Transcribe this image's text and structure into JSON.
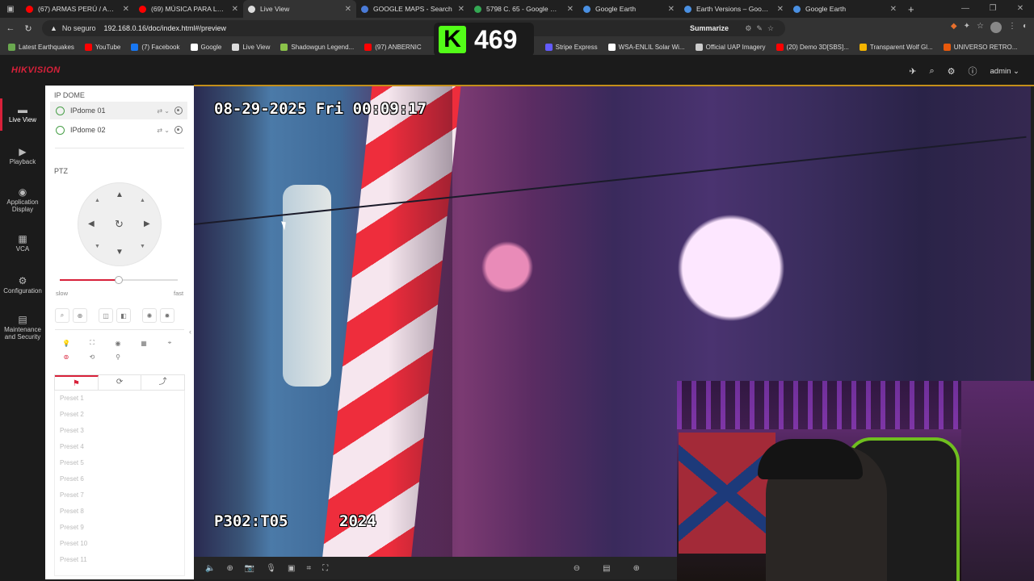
{
  "browser": {
    "tabs": [
      {
        "title": "(67) ARMAS PERÚ / ARMAS",
        "favicon_color": "#ff0000"
      },
      {
        "title": "(69) MÚSICA PARA LEER",
        "favicon_color": "#ff0000"
      },
      {
        "title": "Live View",
        "favicon_color": "#dddddd",
        "active": true
      },
      {
        "title": "GOOGLE MAPS - Search",
        "favicon_color": "#4a7bd8"
      },
      {
        "title": "5798 C. 65 - Google Maps",
        "favicon_color": "#34a853"
      },
      {
        "title": "Google Earth",
        "favicon_color": "#4a90e2"
      },
      {
        "title": "Earth Versions – Google Earth",
        "favicon_color": "#4a90e2"
      },
      {
        "title": "Google Earth",
        "favicon_color": "#4a90e2"
      }
    ],
    "address": {
      "security": "No seguro",
      "url": "192.168.0.16/doc/index.html#/preview",
      "summarize": "Summarize"
    },
    "bookmarks": [
      {
        "label": "Latest Earthquakes",
        "color": "#6aa84f"
      },
      {
        "label": "YouTube",
        "color": "#ff0000"
      },
      {
        "label": "(7) Facebook",
        "color": "#1877f2"
      },
      {
        "label": "Google",
        "color": "#ffffff"
      },
      {
        "label": "Live View",
        "color": "#dddddd"
      },
      {
        "label": "Shadowgun Legend...",
        "color": "#8bc34a"
      },
      {
        "label": "(97) ANBERNIC",
        "color": "#ff0000"
      },
      {
        "label": "Stripe Express",
        "color": "#635bff"
      },
      {
        "label": "WSA-ENLIL Solar Wi...",
        "color": "#ffffff"
      },
      {
        "label": "Official UAP Imagery",
        "color": "#cccccc"
      },
      {
        "label": "(20) Demo 3D[SBS]...",
        "color": "#ff0000"
      },
      {
        "label": "Transparent Wolf Gl...",
        "color": "#f4b400"
      },
      {
        "label": "UNIVERSO RETRO...",
        "color": "#e8590c"
      }
    ]
  },
  "overlay": {
    "kick_letter": "K",
    "viewer_count": "469"
  },
  "app": {
    "brand": "HIKVISION",
    "user": "admin",
    "nav": [
      {
        "label": "Live View",
        "active": true
      },
      {
        "label": "Playback"
      },
      {
        "label": "Application Display"
      },
      {
        "label": "VCA"
      },
      {
        "label": "Configuration"
      },
      {
        "label": "Maintenance and Security"
      }
    ],
    "panel": {
      "section_title": "IP DOME",
      "cameras": [
        "IPdome 01",
        "IPdome 02"
      ],
      "ptz_title": "PTZ",
      "speed": {
        "slow": "slow",
        "fast": "fast",
        "value": 0.5
      },
      "presets": [
        "Preset 1",
        "Preset 2",
        "Preset 3",
        "Preset 4",
        "Preset 5",
        "Preset 6",
        "Preset 7",
        "Preset 8",
        "Preset 9",
        "Preset 10",
        "Preset 11"
      ]
    },
    "video": {
      "timestamp": "08-29-2025 Fri 00:09:17",
      "osd_left": "P302:T05",
      "osd_right": "2024"
    }
  }
}
